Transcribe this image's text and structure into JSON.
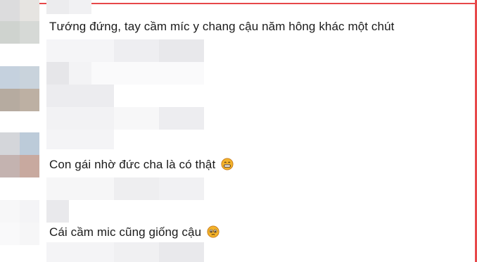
{
  "comments": [
    {
      "text": "Tướng đứng, tay cầm míc y chang cậu năm hông khác một chút",
      "emoji": ""
    },
    {
      "text": "Con gái nhờ đức cha là có thật",
      "emoji": "grinning-face-icon"
    },
    {
      "text": "Cái cầm mic cũng giống cậu ",
      "emoji": "pleading-face-icon"
    }
  ],
  "colors": {
    "accent_line": "#e7484a",
    "text": "#1b1b1b",
    "blur_light": "#f4f4f6",
    "blur_mid": "#e9e9ec",
    "emoji_yellow": "#f4b32a",
    "emoji_outline": "#c4781a"
  }
}
